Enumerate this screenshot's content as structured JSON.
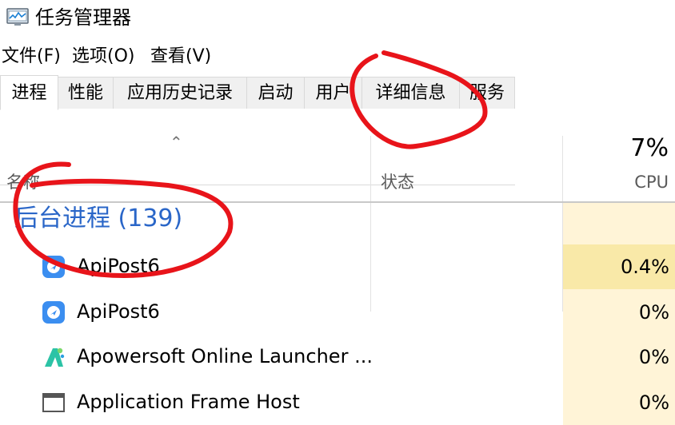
{
  "window": {
    "title": "任务管理器",
    "icon": "task-manager-icon"
  },
  "menu": {
    "items": [
      "文件(F)",
      "选项(O)",
      "查看(V)"
    ]
  },
  "tabs": {
    "items": [
      "进程",
      "性能",
      "应用历史记录",
      "启动",
      "用户",
      "详细信息",
      "服务"
    ],
    "active": "进程"
  },
  "columns": {
    "name_label": "名称",
    "status_label": "状态",
    "cpu_percent": "7%",
    "cpu_label": "CPU"
  },
  "group": {
    "title": "后台进程 (139)"
  },
  "processes": [
    {
      "name": "ApiPost6",
      "cpu": "0.4%",
      "icon": "apipost-icon"
    },
    {
      "name": "ApiPost6",
      "cpu": "0%",
      "icon": "apipost-icon"
    },
    {
      "name": "Apowersoft Online Launcher ...",
      "cpu": "0%",
      "icon": "apowersoft-icon"
    },
    {
      "name": "Application Frame Host",
      "cpu": "0%",
      "icon": "app-window-icon"
    }
  ],
  "colors": {
    "group_title": "#2a66c8",
    "cpu_highlight": "#f9e9a8",
    "cpu_light": "#fff4d7",
    "annotation": "#e8141a"
  }
}
